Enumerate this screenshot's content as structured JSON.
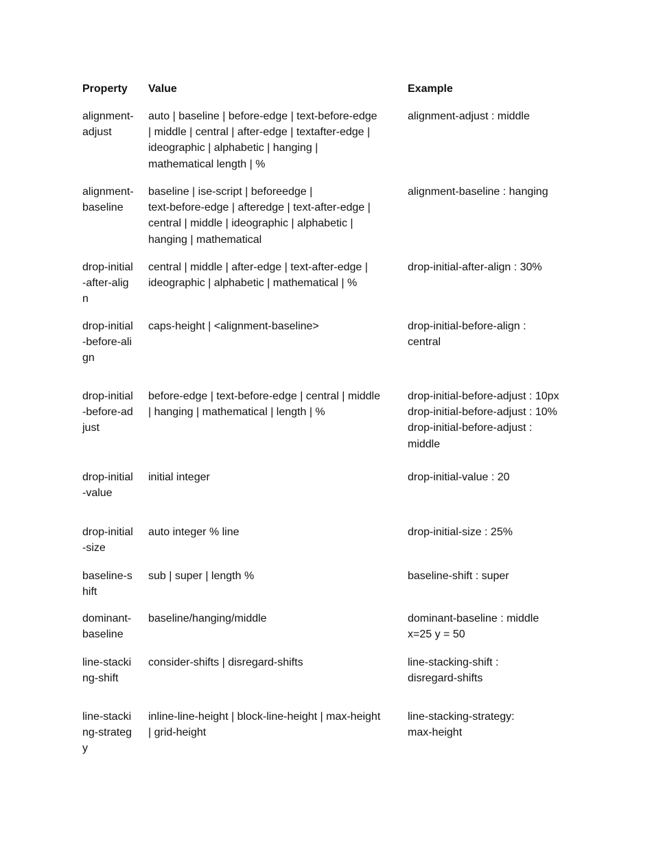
{
  "table": {
    "headers": {
      "property": "Property",
      "value": "Value",
      "example": "Example"
    },
    "rows": [
      {
        "property": [
          "alignment-",
          "adjust"
        ],
        "value": [
          "auto | baseline | before-edge | text-before-edge",
          "| middle | central | after-edge | textafter-edge |",
          "ideographic | alphabetic | hanging |",
          "mathematical length | %"
        ],
        "example": [
          "alignment-adjust : middle"
        ]
      },
      {
        "property": [
          "alignment-",
          "baseline"
        ],
        "value": [
          "baseline | ise-script | beforeedge |",
          "text-before-edge | afteredge | text-after-edge |",
          "central | middle | ideographic | alphabetic |",
          "hanging | mathematical"
        ],
        "example": [
          "alignment-baseline : hanging"
        ]
      },
      {
        "property": [
          "drop-initial",
          "-after-alig",
          "n"
        ],
        "value": [
          "central | middle | after-edge | text-after-edge |",
          "ideographic | alphabetic | mathematical | %"
        ],
        "example": [
          "drop-initial-after-align : 30%"
        ]
      },
      {
        "property": [
          "drop-initial",
          "-before-ali",
          "gn"
        ],
        "value": [
          "caps-height | <alignment-baseline>"
        ],
        "example": [
          "drop-initial-before-align :",
          "central"
        ]
      },
      {
        "property": [
          "drop-initial",
          "-before-ad",
          "just"
        ],
        "value": [
          "before-edge | text-before-edge | central | middle",
          "| hanging | mathematical | length | %"
        ],
        "example": [
          "drop-initial-before-adjust : 10px",
          "drop-initial-before-adjust : 10%",
          "drop-initial-before-adjust :",
          "middle"
        ]
      },
      {
        "property": [
          "drop-initial",
          "-value"
        ],
        "value": [
          "initial integer"
        ],
        "example": [
          "drop-initial-value : 20"
        ]
      },
      {
        "property": [
          "drop-initial",
          "-size"
        ],
        "value": [
          "auto integer % line"
        ],
        "example": [
          "drop-initial-size : 25%"
        ]
      },
      {
        "property": [
          "baseline-s",
          "hift"
        ],
        "value": [
          "sub | super | length %"
        ],
        "example": [
          "baseline-shift : super"
        ]
      },
      {
        "property": [
          "dominant-",
          "baseline"
        ],
        "value": [
          "baseline/hanging/middle"
        ],
        "example": [
          "dominant-baseline : middle",
          "x=25 y = 50"
        ]
      },
      {
        "property": [
          "line-stacki",
          "ng-shift"
        ],
        "value": [
          "consider-shifts | disregard-shifts"
        ],
        "example": [
          "line-stacking-shift :",
          "disregard-shifts"
        ]
      },
      {
        "property": [
          "line-stacki",
          "ng-strateg",
          "y"
        ],
        "value": [
          "inline-line-height | block-line-height | max-height",
          "| grid-height"
        ],
        "example": [
          "line-stacking-strategy:",
          "max-height"
        ]
      }
    ]
  }
}
